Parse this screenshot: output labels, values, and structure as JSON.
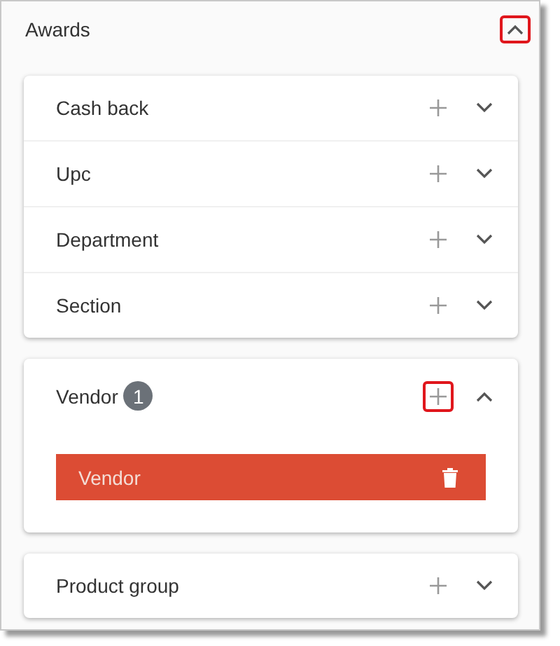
{
  "panel": {
    "title": "Awards",
    "expanded": true,
    "toggle_highlighted": true
  },
  "groups": [
    {
      "sections": [
        {
          "label": "Cash back",
          "expanded": false,
          "add_highlighted": false
        },
        {
          "label": "Upc",
          "expanded": false,
          "add_highlighted": false
        },
        {
          "label": "Department",
          "expanded": false,
          "add_highlighted": false
        },
        {
          "label": "Section",
          "expanded": false,
          "add_highlighted": false
        }
      ]
    },
    {
      "sections": [
        {
          "label": "Vendor",
          "badge": "1",
          "expanded": true,
          "add_highlighted": true,
          "items": [
            {
              "label": "Vendor"
            }
          ]
        }
      ]
    },
    {
      "sections": [
        {
          "label": "Product group",
          "expanded": false,
          "add_highlighted": false
        }
      ]
    }
  ]
}
